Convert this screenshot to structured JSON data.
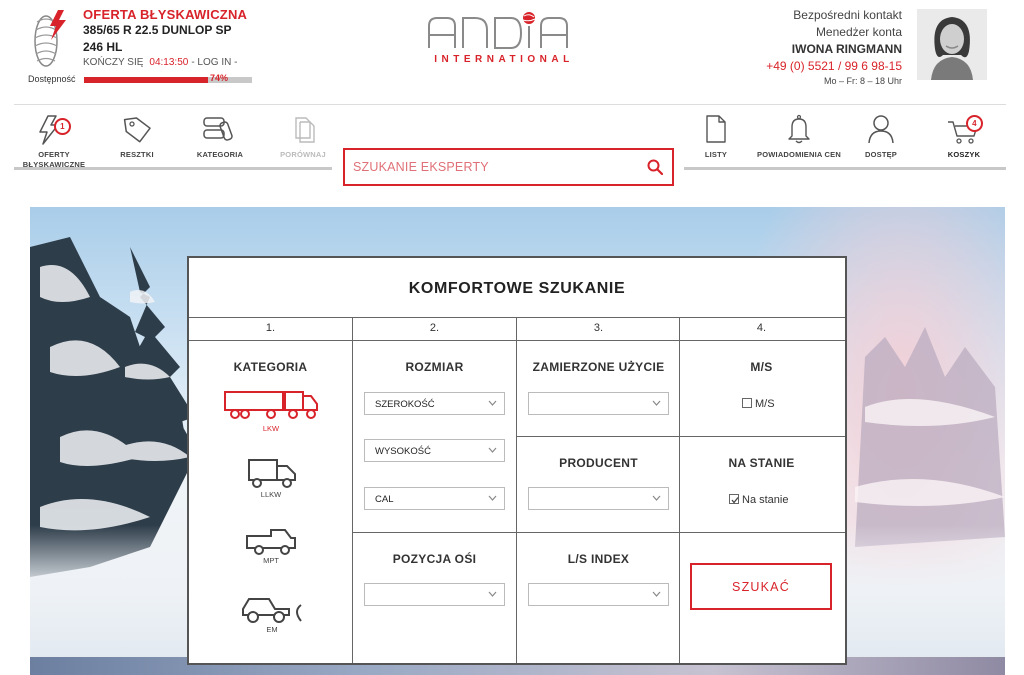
{
  "flash": {
    "title": "OFERTA BŁYSKAWICZNA",
    "product_line1": "385/65 R 22.5 DUNLOP SP",
    "product_line2": "246 HL",
    "ends_label": "KOŃCZY SIĘ",
    "ends_time": "04:13:50",
    "login": "- LOG IN -",
    "availability_label": "Dostępność",
    "availability_value": 0.74,
    "availability_pct": "74%"
  },
  "logo": {
    "brand": "ANDiA",
    "subtitle": "INTERNATIONAL"
  },
  "contact": {
    "line1": "Bezpośredni kontakt",
    "line2": "Menedżer konta",
    "name": "IWONA RINGMANN",
    "phone": "+49 (0) 5521 / 99 6 98-15",
    "hours": "Mo – Fr: 8 – 18 Uhr"
  },
  "nav": {
    "items": [
      {
        "label": "OFERTY BŁYSKAWICZNE",
        "icon": "lightning-icon",
        "badge": "1"
      },
      {
        "label": "RESZTKI",
        "icon": "tag-icon"
      },
      {
        "label": "KATEGORIA",
        "icon": "category-icon"
      },
      {
        "label": "PORÓWNAJ",
        "icon": "compare-icon"
      },
      {
        "label": "LISTY",
        "icon": "document-icon"
      },
      {
        "label": "POWIADOMIENIA CEN",
        "icon": "bell-icon"
      },
      {
        "label": "DOSTĘP",
        "icon": "user-icon"
      },
      {
        "label": "KOSZYK",
        "icon": "cart-icon",
        "badge": "4"
      }
    ]
  },
  "search": {
    "placeholder": "SZUKANIE EKSPERTY"
  },
  "form": {
    "title": "KOMFORTOWE SZUKANIE",
    "steps": [
      "1.",
      "2.",
      "3.",
      "4."
    ],
    "kategoria": {
      "heading": "KATEGORIA",
      "vehicles": [
        {
          "label": "LKW",
          "icon": "truck-trailer-icon",
          "active": true
        },
        {
          "label": "LLKW",
          "icon": "light-truck-icon"
        },
        {
          "label": "MPT",
          "icon": "pickup-icon"
        },
        {
          "label": "EM",
          "icon": "earthmover-icon"
        }
      ]
    },
    "rozmiar": {
      "heading": "ROZMIAR",
      "width": "SZEROKOŚĆ",
      "height": "WYSOKOŚĆ",
      "inch": "CAL"
    },
    "pozycja": {
      "heading": "POZYCJA OŚI",
      "value": ""
    },
    "uzycie": {
      "heading": "ZAMIERZONE UŻYCIE",
      "value": ""
    },
    "producent": {
      "heading": "PRODUCENT",
      "value": ""
    },
    "ls_index": {
      "heading": "L/S INDEX",
      "value": ""
    },
    "ms": {
      "heading": "M/S",
      "checkbox_label": "M/S",
      "checked": false
    },
    "stock": {
      "heading": "NA STANIE",
      "checkbox_label": "Na stanie",
      "checked": true
    },
    "submit": "SZUKAĆ"
  },
  "colors": {
    "accent": "#d8232a",
    "text": "#333333",
    "border": "#666666"
  }
}
